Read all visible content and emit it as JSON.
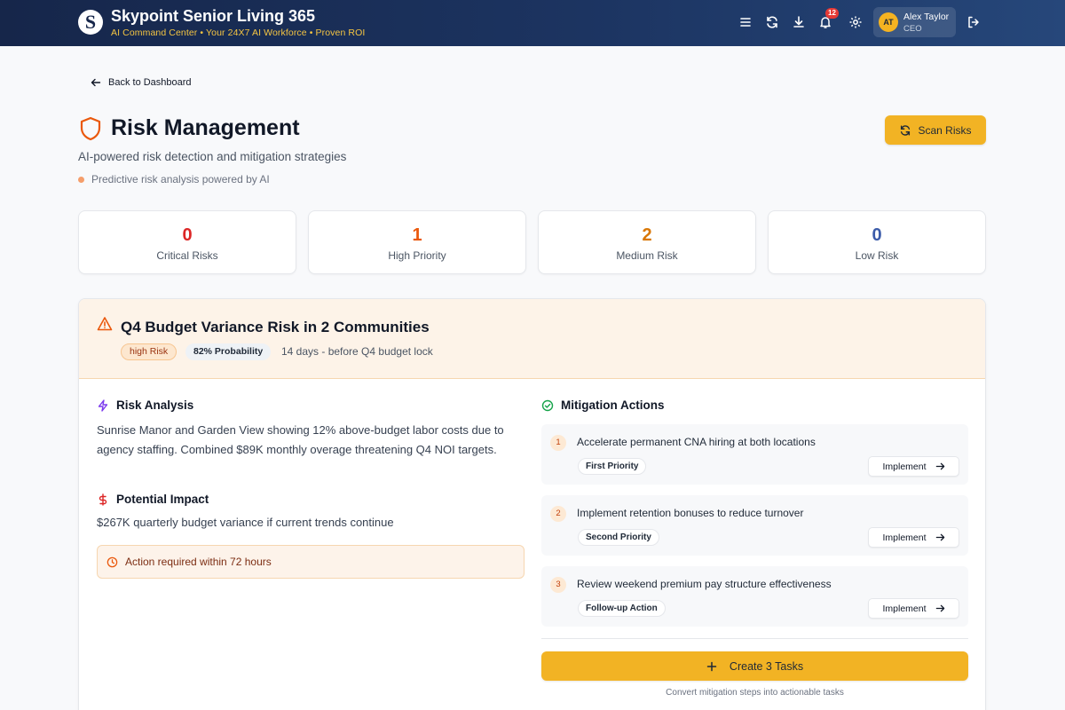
{
  "app": {
    "logo_letter": "S",
    "title": "Skypoint Senior Living 365",
    "subtitle": "AI Command Center • Your 24X7 AI Workforce • Proven ROI",
    "notification_count": "12"
  },
  "header_icons": [
    "menu-icon",
    "refresh-icon",
    "download-icon",
    "bell-icon",
    "gear-icon",
    "logout-icon"
  ],
  "user": {
    "initials": "AT",
    "name": "Alex Taylor",
    "role": "CEO"
  },
  "nav": {
    "back_label": "Back to Dashboard"
  },
  "page": {
    "title": "Risk Management",
    "subtitle": "AI-powered risk detection and mitigation strategies",
    "ai_note": "Predictive risk analysis powered by AI",
    "scan_label": "Scan Risks"
  },
  "stats": [
    {
      "value": "0",
      "label": "Critical Risks",
      "color": "#dc2626"
    },
    {
      "value": "1",
      "label": "High Priority",
      "color": "#ea580c"
    },
    {
      "value": "2",
      "label": "Medium Risk",
      "color": "#d97706"
    },
    {
      "value": "0",
      "label": "Low Risk",
      "color": "#2563eb"
    }
  ],
  "risk": {
    "title": "Q4 Budget Variance Risk in 2 Communities",
    "level": "high Risk",
    "probability": "82% Probability",
    "deadline": "14 days - before Q4 budget lock",
    "analysis_heading": "Risk Analysis",
    "analysis_text": "Sunrise Manor and Garden View showing 12% above-budget labor costs due to agency staffing. Combined $89K monthly overage threatening Q4 NOI targets.",
    "impact_heading": "Potential Impact",
    "impact_text": "$267K quarterly budget variance if current trends continue",
    "alert": "Action required within 72 hours"
  },
  "mitigation": {
    "heading": "Mitigation Actions",
    "implement_label": "Implement",
    "actions": [
      {
        "number": "1",
        "text": "Accelerate permanent CNA hiring at both locations",
        "priority": "First Priority"
      },
      {
        "number": "2",
        "text": "Implement retention bonuses to reduce turnover",
        "priority": "Second Priority"
      },
      {
        "number": "3",
        "text": "Review weekend premium pay structure effectiveness",
        "priority": "Follow-up Action"
      }
    ],
    "create_label": "Create 3 Tasks",
    "create_note": "Convert mitigation steps into actionable tasks"
  },
  "colors": {
    "accent": "#f2b324",
    "header_bg": "#1c3461",
    "alert_orange": "#ea580c"
  }
}
